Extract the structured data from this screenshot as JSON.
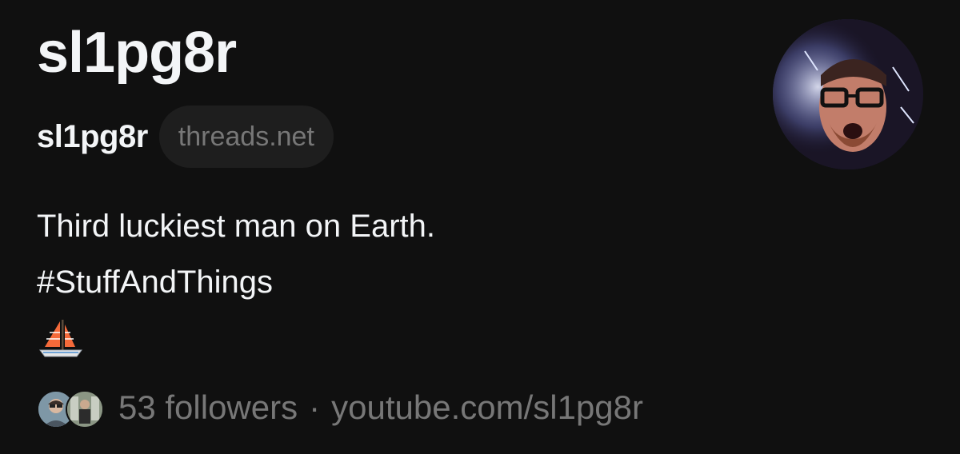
{
  "profile": {
    "display_name": "sl1pg8r",
    "username": "sl1pg8r",
    "domain_badge": "threads.net",
    "bio": {
      "line1": "Third luckiest man on Earth.",
      "line2": "#StuffAndThings",
      "emoji_icon": "sailboat-icon"
    },
    "followers_text": "53 followers",
    "separator": "·",
    "link": "youtube.com/sl1pg8r"
  },
  "colors": {
    "background": "#101010",
    "primary_text": "#f3f5f7",
    "secondary_text": "#777777",
    "chip_background": "#1e1e1e"
  }
}
